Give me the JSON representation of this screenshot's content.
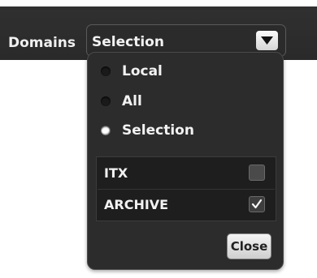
{
  "toolbar": {
    "label": "Domains",
    "select": {
      "value": "Selection",
      "button_icon": "triangle-down-icon"
    }
  },
  "popup": {
    "radio_options": [
      {
        "label": "Local",
        "selected": false
      },
      {
        "label": "All",
        "selected": false
      },
      {
        "label": "Selection",
        "selected": true
      }
    ],
    "domains": [
      {
        "name": "ITX",
        "checked": false
      },
      {
        "name": "ARCHIVE",
        "checked": true
      }
    ],
    "close_label": "Close"
  },
  "colors": {
    "toolbar_bg": "#2e2e2e",
    "popup_bg": "#2c2c2c",
    "text": "#f2f2f2"
  }
}
